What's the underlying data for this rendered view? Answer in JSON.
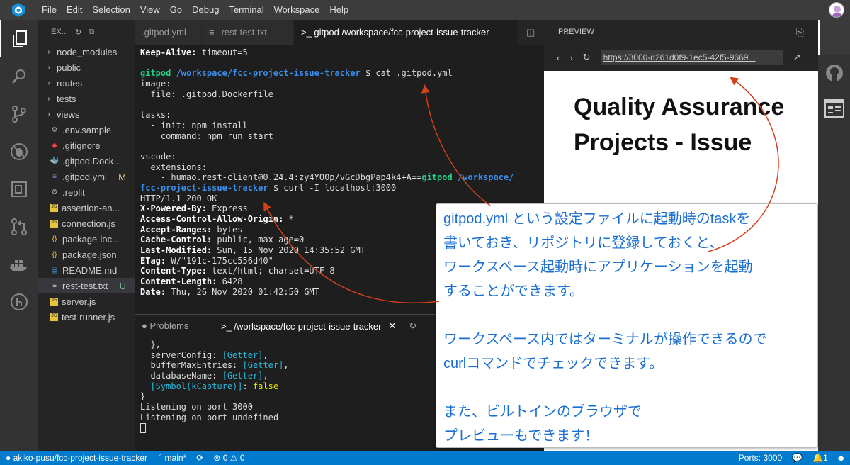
{
  "menu": [
    "File",
    "Edit",
    "Selection",
    "View",
    "Go",
    "Debug",
    "Terminal",
    "Workspace",
    "Help"
  ],
  "explorer": {
    "title": "EX...",
    "files": [
      {
        "name": "node_modules",
        "kind": "folder"
      },
      {
        "name": "public",
        "kind": "folder"
      },
      {
        "name": "routes",
        "kind": "folder"
      },
      {
        "name": "tests",
        "kind": "folder"
      },
      {
        "name": "views",
        "kind": "folder"
      },
      {
        "name": ".env.sample",
        "kind": "gear"
      },
      {
        "name": ".gitignore",
        "kind": "git"
      },
      {
        "name": ".gitpod.Dock...",
        "kind": "docker"
      },
      {
        "name": ".gitpod.yml",
        "kind": "yml",
        "badge": "M"
      },
      {
        "name": ".replit",
        "kind": "gear"
      },
      {
        "name": "assertion-an...",
        "kind": "js"
      },
      {
        "name": "connection.js",
        "kind": "js"
      },
      {
        "name": "package-loc...",
        "kind": "json"
      },
      {
        "name": "package.json",
        "kind": "json"
      },
      {
        "name": "README.md",
        "kind": "md"
      },
      {
        "name": "rest-test.txt",
        "kind": "txt",
        "badge": "U",
        "selected": true
      },
      {
        "name": "server.js",
        "kind": "js"
      },
      {
        "name": "test-runner.js",
        "kind": "js"
      }
    ]
  },
  "tabs": [
    ".gitpod.yml",
    "rest-test.txt",
    ">_ gitpod /workspace/fcc-project-issue-tracker"
  ],
  "terminal1": [
    [
      [
        "Keep-Alive:",
        "w"
      ],
      [
        " timeout=5",
        ""
      ]
    ],
    [
      [
        "",
        ""
      ]
    ],
    [
      [
        "gitpod",
        "g"
      ],
      [
        " /workspace/fcc-project-issue-tracker",
        "b"
      ],
      [
        " $ cat .gitpod.yml",
        ""
      ]
    ],
    [
      [
        "image:",
        ""
      ]
    ],
    [
      [
        "  file: .gitpod.Dockerfile",
        ""
      ]
    ],
    [
      [
        "",
        ""
      ]
    ],
    [
      [
        "tasks:",
        ""
      ]
    ],
    [
      [
        "  - init: npm install",
        ""
      ]
    ],
    [
      [
        "    command: npm run start",
        ""
      ]
    ],
    [
      [
        "",
        ""
      ]
    ],
    [
      [
        "vscode:",
        ""
      ]
    ],
    [
      [
        "  extensions:",
        ""
      ]
    ],
    [
      [
        "    - humao.rest-client@0.24.4:zy4YO0p/vGcDbgPap4k4+A==",
        ""
      ],
      [
        "gitpod",
        "g"
      ],
      [
        " /workspace/",
        "b"
      ]
    ],
    [
      [
        "fcc-project-issue-tracker",
        "b"
      ],
      [
        " $ curl -I localhost:3000",
        ""
      ]
    ],
    [
      [
        "HTTP/1.1 200 OK",
        ""
      ]
    ],
    [
      [
        "X-Powered-By:",
        "w"
      ],
      [
        " Express",
        ""
      ]
    ],
    [
      [
        "Access-Control-Allow-Origin:",
        "w"
      ],
      [
        " *",
        ""
      ]
    ],
    [
      [
        "Accept-Ranges:",
        "w"
      ],
      [
        " bytes",
        ""
      ]
    ],
    [
      [
        "Cache-Control:",
        "w"
      ],
      [
        " public, max-age=0",
        ""
      ]
    ],
    [
      [
        "Last-Modified:",
        "w"
      ],
      [
        " Sun, 15 Nov 2020 14:35:52 GMT",
        ""
      ]
    ],
    [
      [
        "ETag:",
        "w"
      ],
      [
        " W/\"191c-175cc556d40\"",
        ""
      ]
    ],
    [
      [
        "Content-Type:",
        "w"
      ],
      [
        " text/html; charset=UTF-8",
        ""
      ]
    ],
    [
      [
        "Content-Length:",
        "w"
      ],
      [
        " 6428",
        ""
      ]
    ],
    [
      [
        "Date:",
        "w"
      ],
      [
        " Thu, 26 Nov 2020 01:42:50 GMT",
        ""
      ]
    ]
  ],
  "panel": {
    "problems": "Problems",
    "terminal_tab": ">_ /workspace/fcc-project-issue-tracker"
  },
  "terminal2": [
    [
      [
        "  },",
        ""
      ]
    ],
    [
      [
        "  serverConfig: ",
        ""
      ],
      [
        "[Getter]",
        "c"
      ],
      [
        ",",
        ""
      ]
    ],
    [
      [
        "  bufferMaxEntries: ",
        ""
      ],
      [
        "[Getter]",
        "c"
      ],
      [
        ",",
        ""
      ]
    ],
    [
      [
        "  databaseName: ",
        ""
      ],
      [
        "[Getter]",
        "c"
      ],
      [
        ",",
        ""
      ]
    ],
    [
      [
        "  ",
        ""
      ],
      [
        "[Symbol(kCapture)]",
        "c"
      ],
      [
        ": ",
        ""
      ],
      [
        "false",
        "y"
      ]
    ],
    [
      [
        "}",
        ""
      ]
    ],
    [
      [
        "Listening on port 3000",
        ""
      ]
    ],
    [
      [
        "Listening on port undefined",
        ""
      ]
    ]
  ],
  "preview": {
    "header": "PREVIEW",
    "url": "https://3000-d261d0f9-1ec5-42f5-9669...",
    "title": "Quality Assurance Projects - Issue"
  },
  "callout": [
    [
      "gitpod.yml という設定ファイルに起動時のtaskを",
      "書いておき、リポジトリに登録しておくと、",
      "ワークスペース起動時にアプリケーションを起動",
      "することができます。"
    ],
    [
      "ワークスペース内ではターミナルが操作できるので",
      "curlコマンドでチェックできます。"
    ],
    [
      "また、ビルトインのブラウザで",
      "プレビューもできます！"
    ]
  ],
  "status": {
    "repo": "akiko-pusu/fcc-project-issue-tracker",
    "branch": "main*",
    "errors": "0",
    "warnings": "0",
    "ports": "Ports: 3000",
    "bell": "1"
  },
  "colors": {
    "accent": "#007acc",
    "callout_text": "#1a6fd1",
    "arrow": "#d0401a"
  }
}
